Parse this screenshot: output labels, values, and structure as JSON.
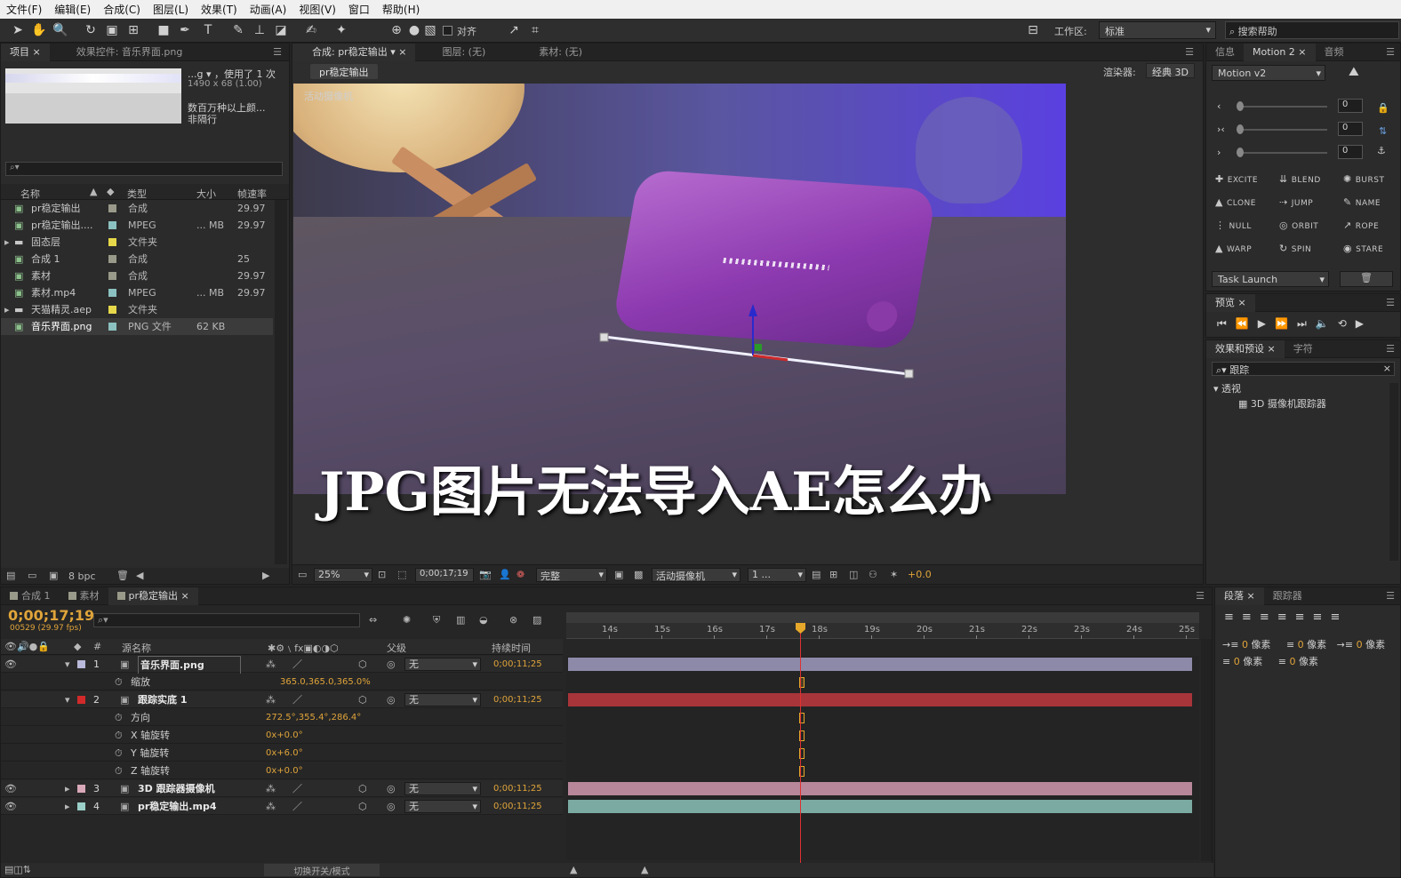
{
  "menu": [
    "文件(F)",
    "编辑(E)",
    "合成(C)",
    "图层(L)",
    "效果(T)",
    "动画(A)",
    "视图(V)",
    "窗口",
    "帮助(H)"
  ],
  "toolbar": {
    "snap_label": "对齐",
    "workspace_label": "工作区:",
    "workspace_value": "标准",
    "search_placeholder": "搜索帮助"
  },
  "project": {
    "tab_project": "项目",
    "tab_effects": "效果控件: 音乐界面.png",
    "preview_name": "...g ▾ ，使用了 1 次",
    "preview_dims": "1490 x 68 (1.00)",
    "preview_desc1": "数百万种以上颜...",
    "preview_desc2": "非隔行",
    "columns": [
      "名称",
      "类型",
      "大小",
      "帧速率"
    ],
    "items": [
      {
        "name": "pr稳定输出",
        "type": "合成",
        "size": "",
        "fps": "29.97",
        "color": "#9a9a8a"
      },
      {
        "name": "pr稳定输出....",
        "type": "MPEG",
        "size": "... MB",
        "fps": "29.97",
        "color": "#8cc1c1"
      },
      {
        "name": "固态层",
        "type": "文件夹",
        "size": "",
        "fps": "",
        "color": "#e6d84a"
      },
      {
        "name": "合成 1",
        "type": "合成",
        "size": "",
        "fps": "25",
        "color": "#9a9a8a"
      },
      {
        "name": "素材",
        "type": "合成",
        "size": "",
        "fps": "29.97",
        "color": "#9a9a8a"
      },
      {
        "name": "素材.mp4",
        "type": "MPEG",
        "size": "... MB",
        "fps": "29.97",
        "color": "#8cc1c1"
      },
      {
        "name": "天猫精灵.aep",
        "type": "文件夹",
        "size": "",
        "fps": "",
        "color": "#e6d84a"
      },
      {
        "name": "音乐界面.png",
        "type": "PNG 文件",
        "size": "62 KB",
        "fps": "",
        "color": "#8cc1c1"
      }
    ],
    "bpc": "8 bpc"
  },
  "comp": {
    "tab_label": "合成: pr稳定输出",
    "layer_label": "图层: (无)",
    "footage_label": "素材: (无)",
    "subtab": "pr稳定输出",
    "renderer_label": "渲染器:",
    "renderer_value": "经典 3D",
    "view_label": "活动摄像机",
    "overlay_title": "JPG图片无法导入AE怎么办",
    "zoom": "25%",
    "timecode": "0;00;17;19",
    "quality": "完整",
    "camera": "活动摄像机",
    "views": "1 ...",
    "exposure": "+0.0"
  },
  "info": {
    "tab_info": "信息",
    "tab_motion": "Motion 2",
    "tab_audio": "音频",
    "motion_version": "Motion v2",
    "slider_values": [
      "0",
      "0",
      "0"
    ],
    "buttons": [
      "EXCITE",
      "BLEND",
      "BURST",
      "CLONE",
      "JUMP",
      "NAME",
      "NULL",
      "ORBIT",
      "ROPE",
      "WARP",
      "SPIN",
      "STARE"
    ],
    "task_launch": "Task Launch"
  },
  "preview": {
    "tab": "预览"
  },
  "effects": {
    "tab": "效果和预设",
    "tab2": "字符",
    "search": "跟踪",
    "category": "透视",
    "item": "3D 摄像机跟踪器"
  },
  "paragraph": {
    "tab": "段落",
    "tab2": "跟踪器",
    "px": "像素",
    "zero": "0"
  },
  "timeline": {
    "tabs": [
      "合成 1",
      "素材",
      "pr稳定输出"
    ],
    "timecode": "0;00;17;19",
    "frames": "00529 (29.97 fps)",
    "col_source": "源名称",
    "col_parent": "父级",
    "col_duration": "持续时间",
    "ruler": [
      "14s",
      "15s",
      "16s",
      "17s",
      "18s",
      "19s",
      "20s",
      "21s",
      "22s",
      "23s",
      "24s",
      "25s"
    ],
    "layers": [
      {
        "num": "1",
        "name": "音乐界面.png",
        "color": "#b9b9d9",
        "parent": "无",
        "duration": "0;00;11;25",
        "bar": "#8d8aa9"
      },
      {
        "num": "",
        "name": "缩放",
        "value": "365.0,365.0,365.0%",
        "prop": true
      },
      {
        "num": "2",
        "name": "跟踪实底 1",
        "color": "#d22a2a",
        "parent": "无",
        "duration": "0;00;11;25",
        "bar": "#a8353a"
      },
      {
        "num": "",
        "name": "方向",
        "value": "272.5°,355.4°,286.4°",
        "prop": true
      },
      {
        "num": "",
        "name": "X 轴旋转",
        "value": "0x+0.0°",
        "prop": true
      },
      {
        "num": "",
        "name": "Y 轴旋转",
        "value": "0x+6.0°",
        "prop": true
      },
      {
        "num": "",
        "name": "Z 轴旋转",
        "value": "0x+0.0°",
        "prop": true
      },
      {
        "num": "3",
        "name": "3D 跟踪器摄像机",
        "color": "#d9a9b9",
        "parent": "无",
        "duration": "0;00;11;25",
        "bar": "#b8879a"
      },
      {
        "num": "4",
        "name": "pr稳定输出.mp4",
        "color": "#9ad0c8",
        "parent": "无",
        "duration": "0;00;11;25",
        "bar": "#7aaaa2"
      }
    ],
    "bottom_label": "切换开关/模式"
  }
}
